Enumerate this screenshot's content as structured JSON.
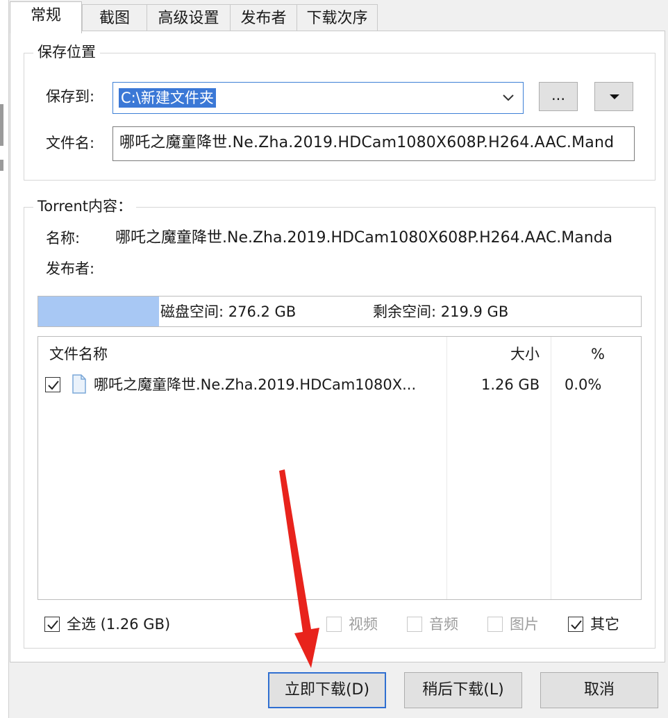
{
  "tabs": [
    {
      "label": "常规",
      "active": true
    },
    {
      "label": "截图"
    },
    {
      "label": "高级设置"
    },
    {
      "label": "发布者"
    },
    {
      "label": "下载次序"
    }
  ],
  "save_location": {
    "legend": "保存位置",
    "save_to_label": "保存到:",
    "path_value": "C:\\新建文件夹",
    "browse_label": "...",
    "filename_label": "文件名:",
    "filename_value": "哪吒之魔童降世.Ne.Zha.2019.HDCam1080X608P.H264.AAC.Mand"
  },
  "torrent": {
    "legend": "Torrent内容：",
    "name_label": "名称:",
    "name_value": "哪吒之魔童降世.Ne.Zha.2019.HDCam1080X608P.H264.AAC.Manda",
    "publisher_label": "发布者:",
    "publisher_value": "",
    "disk_space": "磁盘空间: 276.2 GB",
    "free_space": "剩余空间: 219.9 GB",
    "free_fraction": 0.2
  },
  "file_table": {
    "headers": {
      "name": "文件名称",
      "size": "大小",
      "percent": "%"
    },
    "rows": [
      {
        "checked": true,
        "name": "哪吒之魔童降世.Ne.Zha.2019.HDCam1080X...",
        "size": "1.26 GB",
        "percent": "0.0%"
      }
    ]
  },
  "filters": {
    "select_all": "全选 (1.26 GB)",
    "video": "视频",
    "audio": "音频",
    "image": "图片",
    "other": "其它"
  },
  "buttons": {
    "download_now": "立即下载(D)",
    "download_later": "稍后下载(L)",
    "cancel": "取消"
  },
  "colors": {
    "selection": "#3b78d6",
    "disk_fill": "#a8c8f4",
    "default_button_border": "#2f6fd1",
    "annotation_arrow": "#e8231c"
  }
}
